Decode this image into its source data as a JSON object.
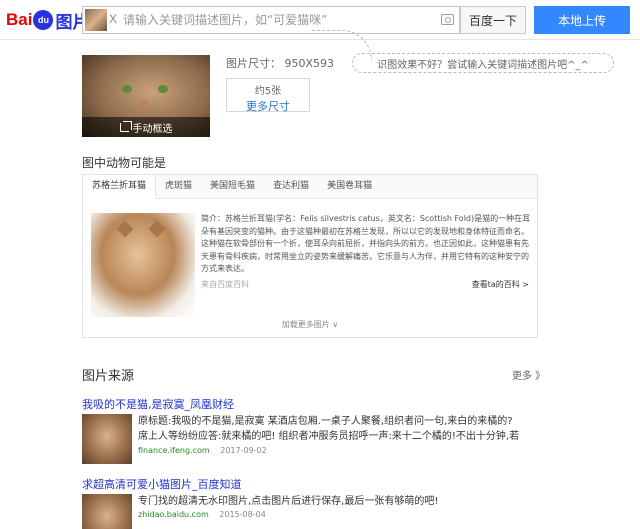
{
  "header": {
    "logo_bai": "Bai",
    "logo_du": "du",
    "logo_tupian": "图片",
    "search_clear": "X",
    "search_placeholder": "请输入关键词描述图片，如“可爱猫咪”",
    "search_button": "百度一下",
    "upload_button": "本地上传"
  },
  "image_info": {
    "crop_label": "手动框选",
    "size_label": "图片尺寸：  950X593",
    "count_label": "约5张",
    "more_sizes": "更多尺寸"
  },
  "tip": {
    "text": "识图效果不好？尝试输入关键词描述图片吧^_^"
  },
  "animal": {
    "section_title": "图中动物可能是",
    "tabs": [
      "苏格兰折耳猫",
      "虎斑猫",
      "美国短毛猫",
      "查达利猫",
      "美国卷耳猫"
    ],
    "intro": "简介：苏格兰折耳猫(学名：Felis silvestris catus，英文名：Scottish Fold)是猫的一种在耳朵有基因突变的猫种。由于这猫种最初在苏格兰发现，所以以它的发现地和身体特征而命名。这种猫在软骨部份有一个折，使耳朵向前屈折，并指向头的前方。也正因如此，这种猫患有先天患有骨科疾病，时常用坐立的姿势来缓解痛苦。它乐意与人为伴，并用它特有的这种安宁的方式来表达。",
    "source": "来自百度百科",
    "baike_link": "查看ta的百科 >",
    "load_more": "加载更多图片 ∨"
  },
  "sources": {
    "title": "图片来源",
    "more": "更多 》",
    "results": [
      {
        "title": "我吸的不是猫,是寂寞_凤凰财经",
        "desc_line1": "原标题:我吸的不是猫,是寂寞 某酒店包厢.一桌子人聚餐,组织者问一句,来白的来橘的?",
        "desc_line2": "席上人等纷纷应答:就来橘的吧! 组织者冲服务员招呼一声:来十二个橘的!不出十分钟,若",
        "site": "finance.ifeng.com",
        "date": "2017-09-02"
      },
      {
        "title": "求超高清可爱小猫图片_百度知道",
        "desc_line1": "专门找的超清无水印图片,点击图片后进行保存,最后一张有够萌的吧!",
        "desc_line2": "",
        "site": "zhidao.baidu.com",
        "date": "2015-08-04"
      }
    ]
  }
}
